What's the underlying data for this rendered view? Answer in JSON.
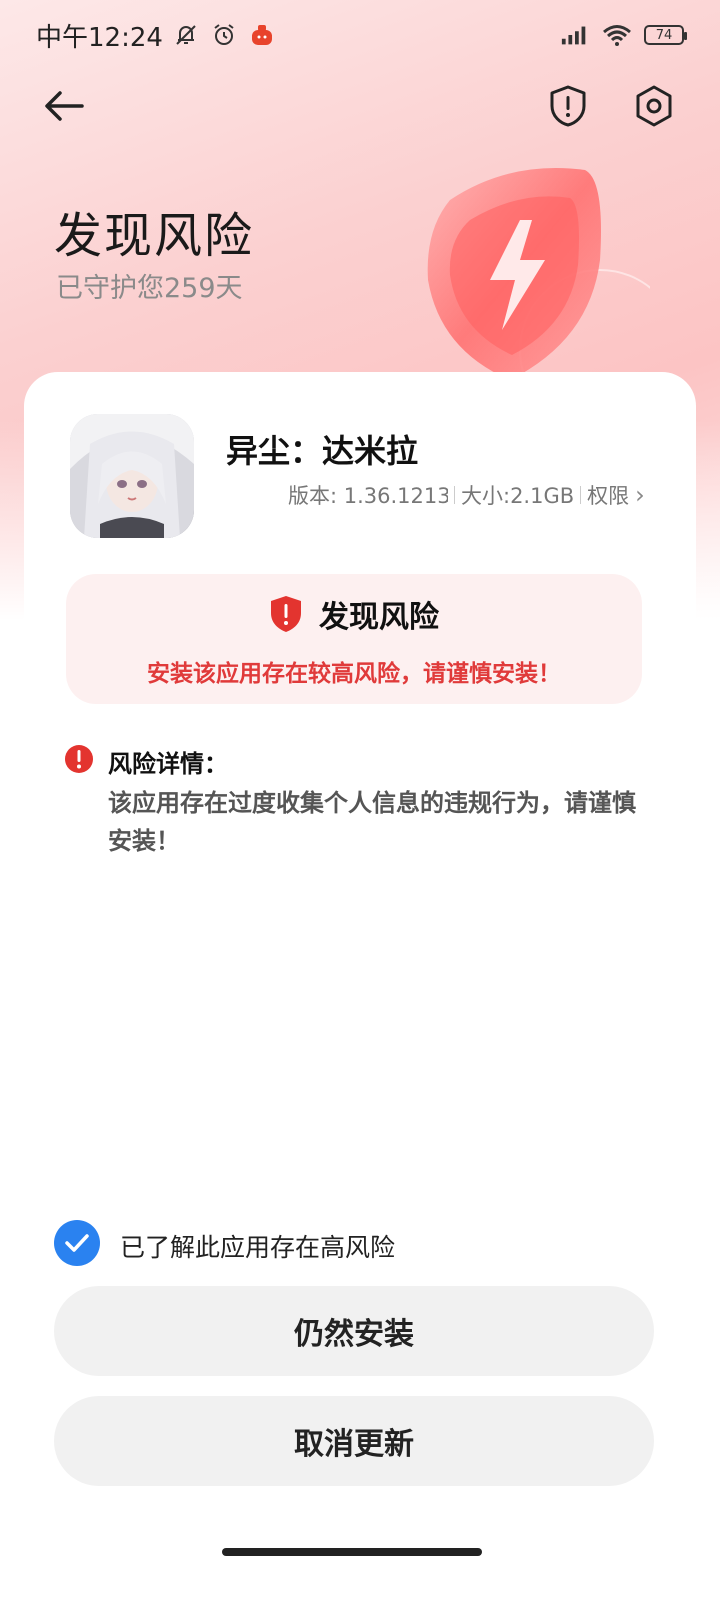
{
  "status_bar": {
    "time": "中午12:24",
    "battery": "74"
  },
  "header": {
    "title": "发现风险",
    "subtitle": "已守护您259天"
  },
  "app": {
    "name": "异尘：达米拉",
    "version": "版本: 1.36.12131",
    "size": "大小:2.1GB",
    "permissions": "权限",
    "permissions_arrow": "›"
  },
  "risk_box": {
    "title": "发现风险",
    "warning": "安装该应用存在较高风险，请谨慎安装！"
  },
  "detail": {
    "label": "风险详情：",
    "text": "该应用存在过度收集个人信息的违规行为，请谨慎安装！"
  },
  "ack": {
    "label": "已了解此应用存在高风险",
    "checked": true
  },
  "buttons": {
    "install": "仍然安装",
    "cancel": "取消更新"
  },
  "colors": {
    "accent_blue": "#2a82f0",
    "risk_red": "#e03a3a",
    "risk_bg": "#fdf0f0"
  }
}
